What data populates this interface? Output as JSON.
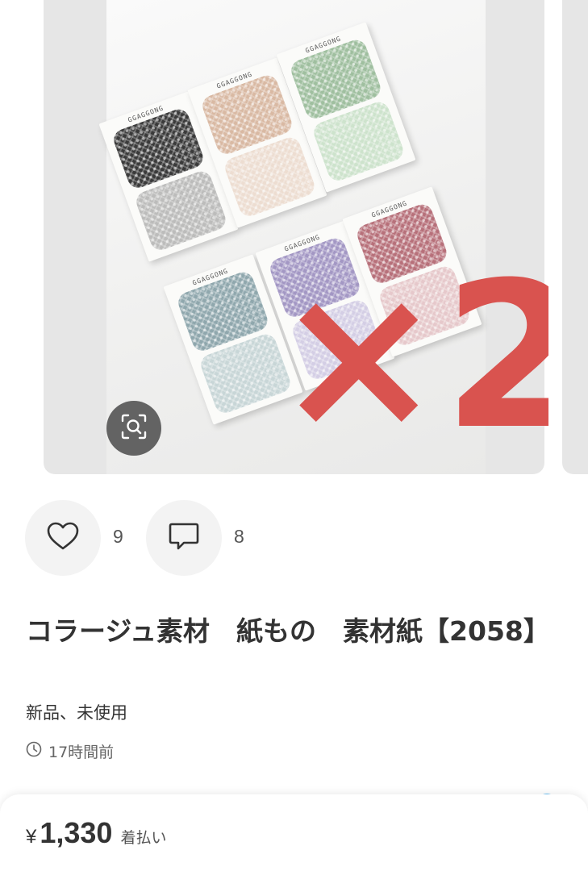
{
  "item": {
    "title": "コラージュ素材　紙もの　素材紙【2058】",
    "condition": "新品、未使用",
    "posted_ago": "17時間前"
  },
  "image": {
    "overlay_text": "×2",
    "pad_brand": "GGAGGONG",
    "pad_colors": [
      "#3a3a3a",
      "#d9b9a3",
      "#9fbf9f",
      "#8fa7ad",
      "#a397c4",
      "#b7707a"
    ],
    "overlay_color": "#d9534f"
  },
  "actions": {
    "like_count": "9",
    "comment_count": "8"
  },
  "price": {
    "currency": "¥",
    "amount": "1,330",
    "shipping": "着払い"
  },
  "icons": {
    "lens": "image-search-icon",
    "like": "heart-icon",
    "comment": "comment-icon",
    "time": "clock-icon"
  }
}
